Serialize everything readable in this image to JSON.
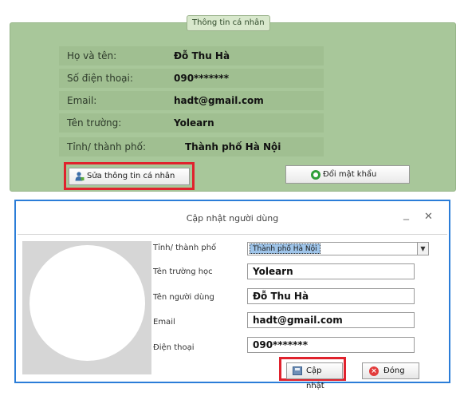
{
  "profile_panel": {
    "legend": "Thông tin cá nhân",
    "rows": [
      {
        "label": "Họ và tên:",
        "value": "Đỗ Thu Hà"
      },
      {
        "label": "Số điện thoại:",
        "value": "090*******"
      },
      {
        "label": "Email:",
        "value": "hadt@gmail.com"
      },
      {
        "label": "Tên trường:",
        "value": "Yolearn"
      },
      {
        "label": "Tỉnh/ thành phố:",
        "value": "Thành phố Hà Nội"
      }
    ],
    "edit_button": "Sửa thông tin cá nhân",
    "change_password_button": "Đổi mật khẩu"
  },
  "dialog": {
    "title": "Cập nhật người dùng",
    "minimize_glyph": "_",
    "close_glyph": "✕",
    "fields": {
      "province": {
        "label": "Tỉnh/ thành phố",
        "value": "Thành phố Hà Nội"
      },
      "school": {
        "label": "Tên trường học",
        "value": "Yolearn"
      },
      "username": {
        "label": "Tên người dùng",
        "value": "Đỗ Thu Hà"
      },
      "email": {
        "label": "Email",
        "value": "hadt@gmail.com"
      },
      "phone": {
        "label": "Điện thoại",
        "value": "090*******"
      }
    },
    "update_button": "Cập nhật",
    "close_button": "Đóng"
  },
  "colors": {
    "panel_green": "#a8c79a",
    "dialog_border": "#2b7dd8",
    "highlight_red": "#e0222d",
    "select_highlight": "#9fc5ea"
  },
  "icons": {
    "edit": "user-edit-icon",
    "password": "key-icon",
    "update": "save-icon",
    "close": "close-circle-icon"
  }
}
